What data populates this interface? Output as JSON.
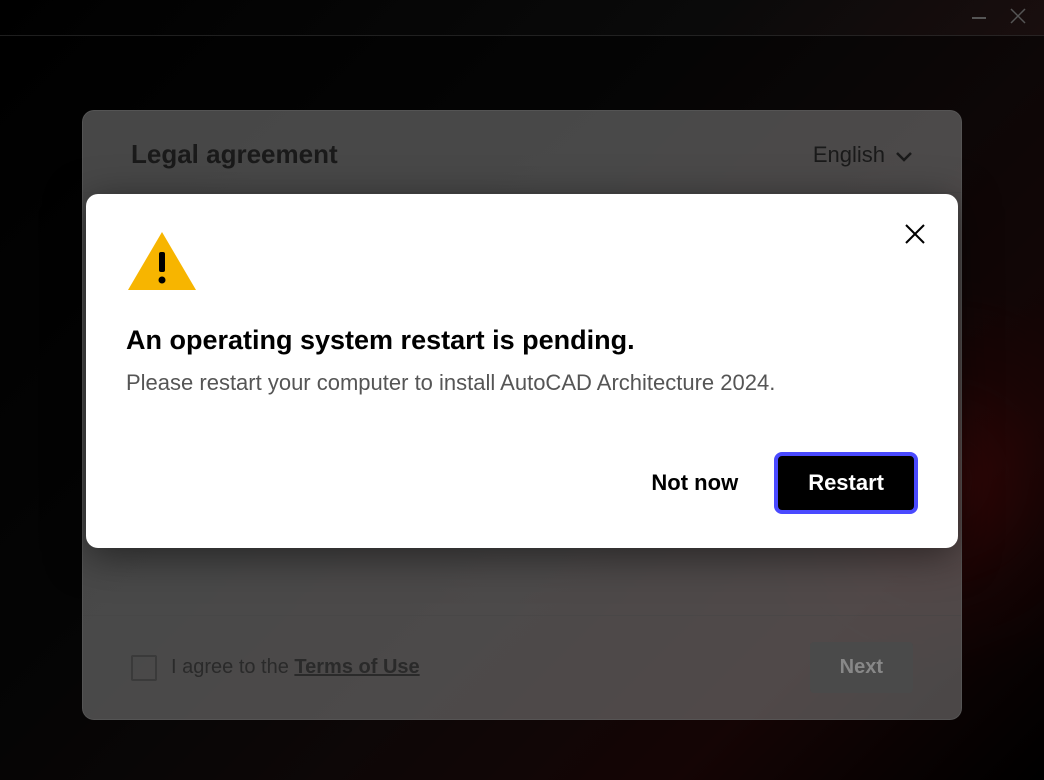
{
  "installer": {
    "title": "Legal agreement",
    "language": "English",
    "agree_prefix": "I agree to the ",
    "terms_link": "Terms of Use",
    "next_label": "Next"
  },
  "modal": {
    "heading": "An operating system restart is pending.",
    "body": "Please restart your computer to install AutoCAD Architecture 2024.",
    "not_now_label": "Not now",
    "restart_label": "Restart"
  }
}
